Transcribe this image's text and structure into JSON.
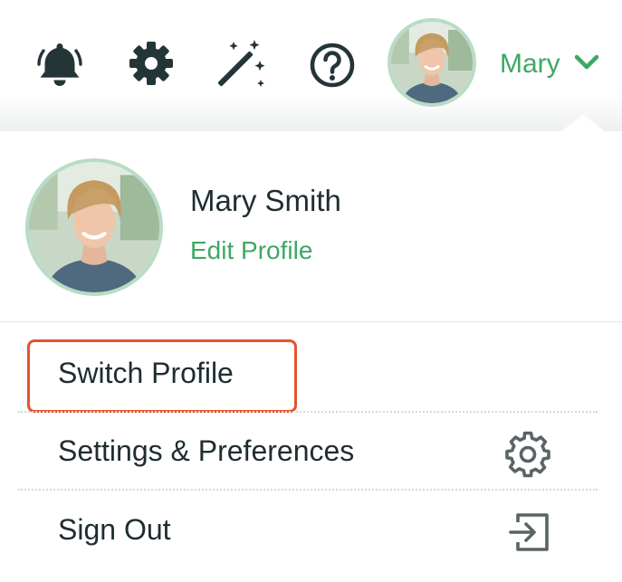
{
  "header": {
    "user_name": "Mary",
    "icons": {
      "notifications": "bell-icon",
      "settings": "gear-icon",
      "magic": "magic-wand-icon",
      "help": "help-icon",
      "dropdown": "chevron-down-icon"
    }
  },
  "profile": {
    "full_name": "Mary Smith",
    "edit_label": "Edit Profile"
  },
  "menu": {
    "items": [
      {
        "label": "Switch Profile"
      },
      {
        "label": "Settings & Preferences",
        "icon": "gear-icon"
      },
      {
        "label": "Sign Out",
        "icon": "sign-out-icon"
      }
    ]
  },
  "colors": {
    "accent": "#3da865",
    "text": "#1f2d30",
    "icon": "#243538",
    "avatar_ring": "#b8dcc6",
    "highlight": "#e5532e",
    "menu_icon": "#5a6466"
  }
}
